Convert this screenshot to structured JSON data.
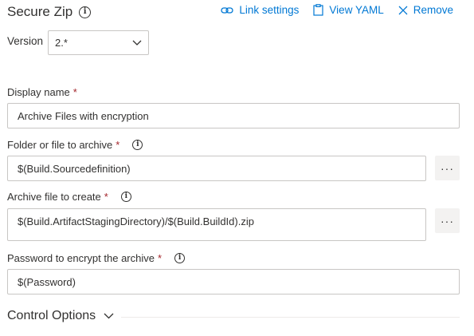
{
  "header": {
    "title": "Secure Zip",
    "link_settings": "Link settings",
    "view_yaml": "View YAML",
    "remove": "Remove"
  },
  "version": {
    "label": "Version",
    "value": "2.*"
  },
  "fields": {
    "display_name": {
      "label": "Display name",
      "value": "Archive Files with encryption"
    },
    "folder_to_archive": {
      "label": "Folder or file to archive",
      "value": "$(Build.Sourcedefinition)"
    },
    "archive_file": {
      "label": "Archive file to create",
      "value": "$(Build.ArtifactStagingDirectory)/$(Build.BuildId).zip"
    },
    "password": {
      "label": "Password to encrypt the archive",
      "value": "$(Password)"
    }
  },
  "required_marker": "*",
  "ellipsis": "···",
  "control_options": {
    "label": "Control Options"
  },
  "colors": {
    "accent": "#0078d4",
    "required": "#a4262c",
    "border": "#c8c6c4",
    "button_bg": "#f3f2f1"
  }
}
